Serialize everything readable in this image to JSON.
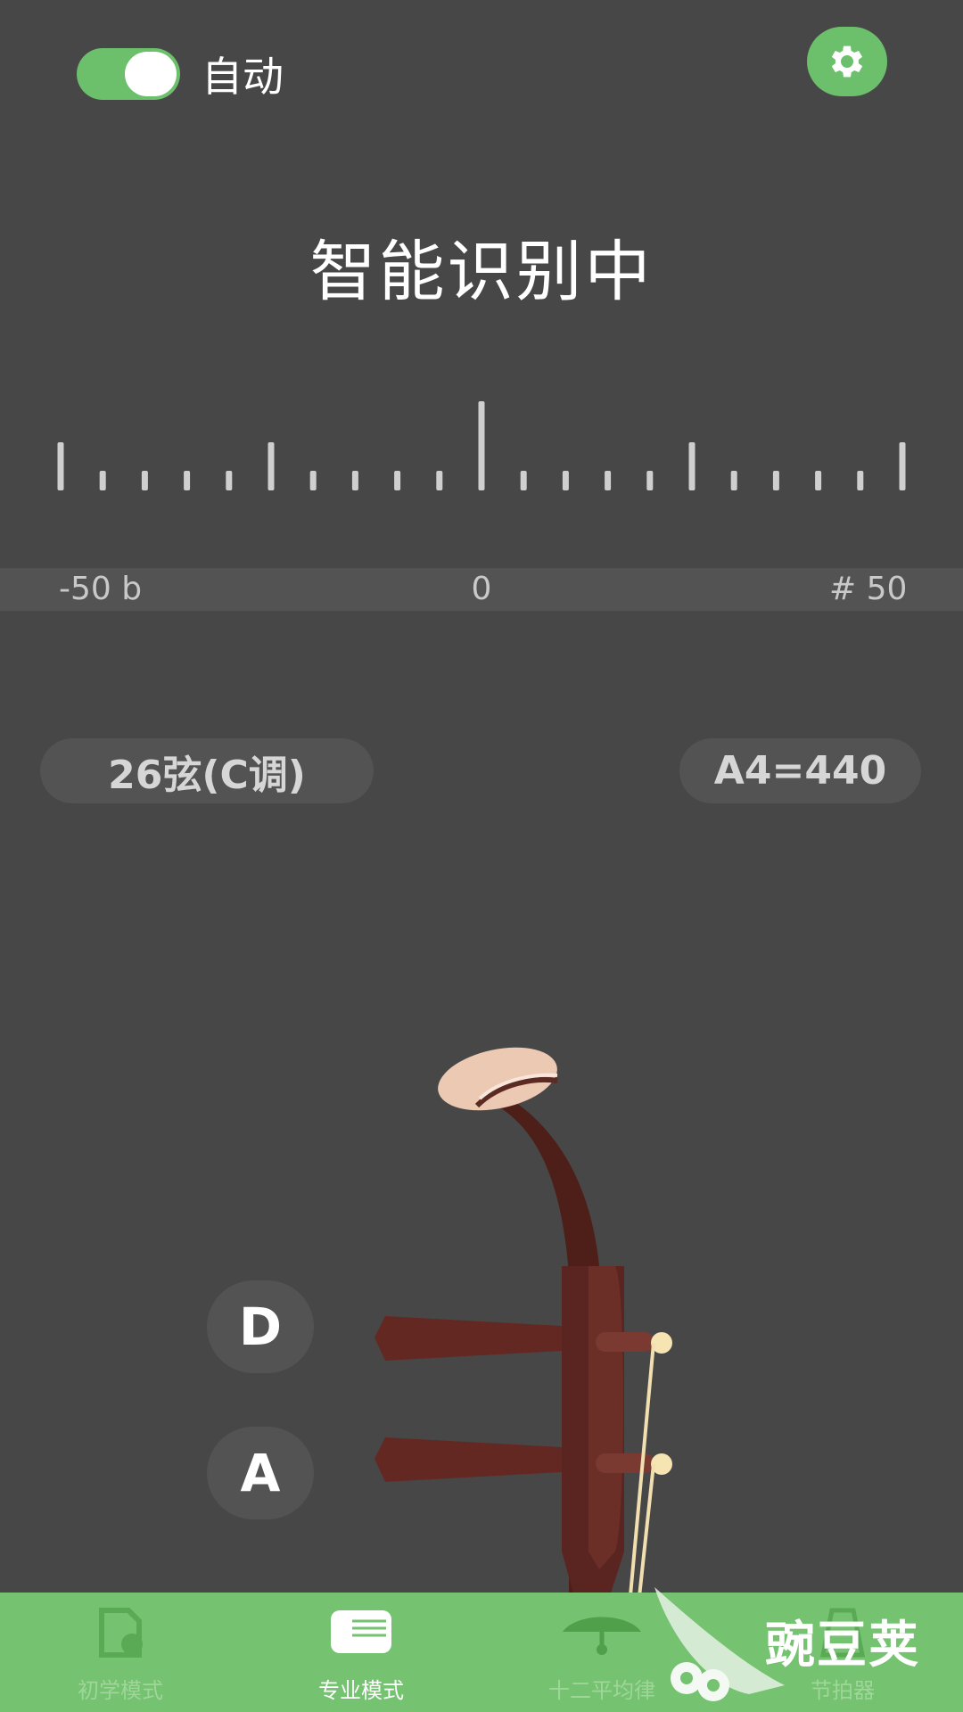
{
  "header": {
    "auto_toggle_on": true,
    "auto_label": "自动",
    "settings_icon": "gear-icon"
  },
  "status_text": "智能识别中",
  "meter": {
    "min_label": "-50 b",
    "center_label": "0",
    "max_label": "# 50"
  },
  "tuning": {
    "instrument_label": "26弦(C调)",
    "reference_label": "A4=440"
  },
  "strings": [
    {
      "label": "D"
    },
    {
      "label": "A"
    }
  ],
  "nav": {
    "items": [
      {
        "label": "初学模式",
        "icon": "beginner-icon",
        "active": false
      },
      {
        "label": "专业模式",
        "icon": "pro-icon",
        "active": true
      },
      {
        "label": "十二平均律",
        "icon": "temperament-icon",
        "active": false
      },
      {
        "label": "节拍器",
        "icon": "metronome-icon",
        "active": false
      }
    ]
  },
  "watermark": {
    "text": "豌豆荚"
  },
  "colors": {
    "background": "#474747",
    "accent_green": "#6cc06c",
    "nav_green": "#75c270",
    "erhu_wood": "#5e2720"
  }
}
